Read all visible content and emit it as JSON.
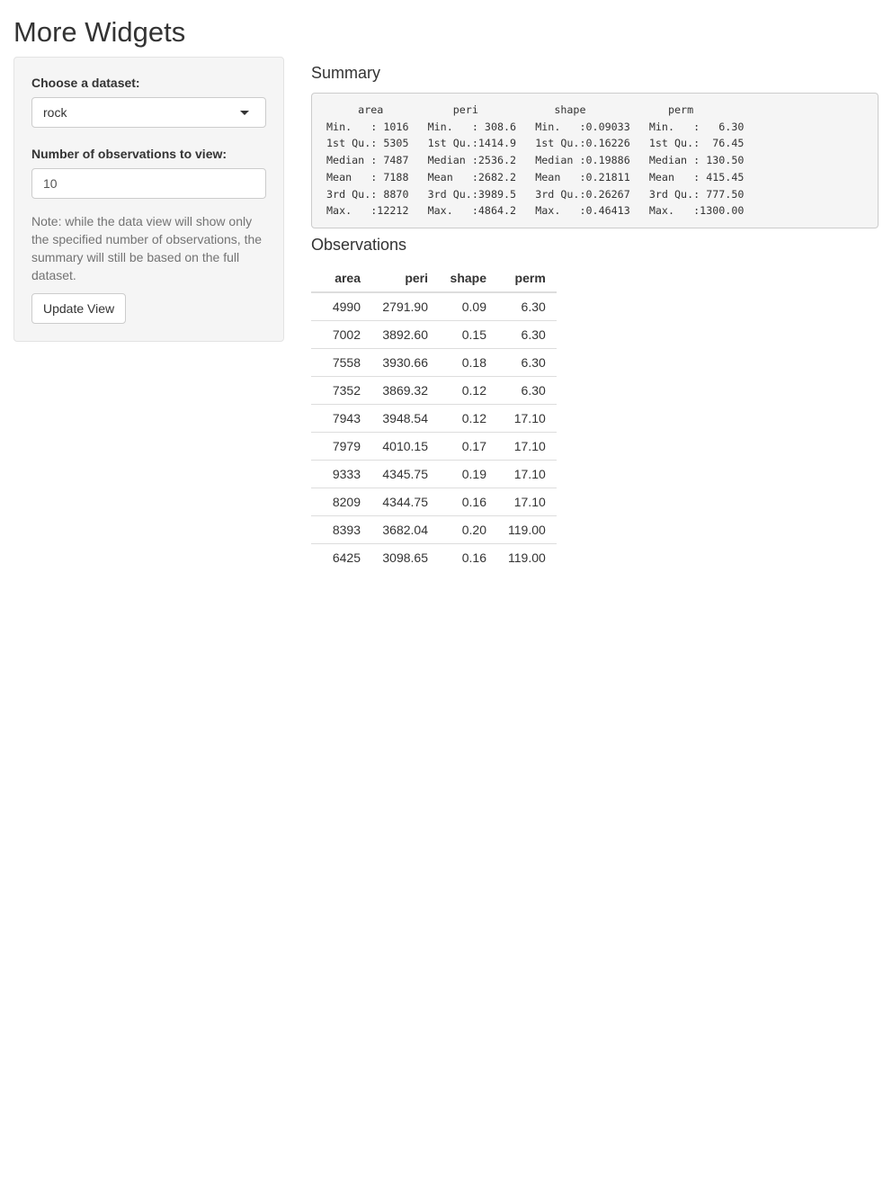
{
  "page": {
    "title": "More Widgets"
  },
  "sidebar": {
    "dataset_label": "Choose a dataset:",
    "dataset_value": "rock",
    "obs_label": "Number of observations to view:",
    "obs_value": "10",
    "note": "Note: while the data view will show only the specified number of observations, the summary will still be based on the full dataset.",
    "update_button": "Update View"
  },
  "summary": {
    "heading": "Summary",
    "lines": [
      "     area           peri            shape             perm        ",
      "Min.   : 1016   Min.   : 308.6   Min.   :0.09033   Min.   :   6.30  ",
      "1st Qu.: 5305   1st Qu.:1414.9   1st Qu.:0.16226   1st Qu.:  76.45  ",
      "Median : 7487   Median :2536.2   Median :0.19886   Median : 130.50  ",
      "Mean   : 7188   Mean   :2682.2   Mean   :0.21811   Mean   : 415.45  ",
      "3rd Qu.: 8870   3rd Qu.:3989.5   3rd Qu.:0.26267   3rd Qu.: 777.50  ",
      "Max.   :12212   Max.   :4864.2   Max.   :0.46413   Max.   :1300.00  "
    ]
  },
  "observations": {
    "heading": "Observations",
    "columns": [
      "area",
      "peri",
      "shape",
      "perm"
    ],
    "rows": [
      [
        "4990",
        "2791.90",
        "0.09",
        "6.30"
      ],
      [
        "7002",
        "3892.60",
        "0.15",
        "6.30"
      ],
      [
        "7558",
        "3930.66",
        "0.18",
        "6.30"
      ],
      [
        "7352",
        "3869.32",
        "0.12",
        "6.30"
      ],
      [
        "7943",
        "3948.54",
        "0.12",
        "17.10"
      ],
      [
        "7979",
        "4010.15",
        "0.17",
        "17.10"
      ],
      [
        "9333",
        "4345.75",
        "0.19",
        "17.10"
      ],
      [
        "8209",
        "4344.75",
        "0.16",
        "17.10"
      ],
      [
        "8393",
        "3682.04",
        "0.20",
        "119.00"
      ],
      [
        "6425",
        "3098.65",
        "0.16",
        "119.00"
      ]
    ]
  },
  "icons": {
    "dropdown": "chevron-down-icon"
  }
}
